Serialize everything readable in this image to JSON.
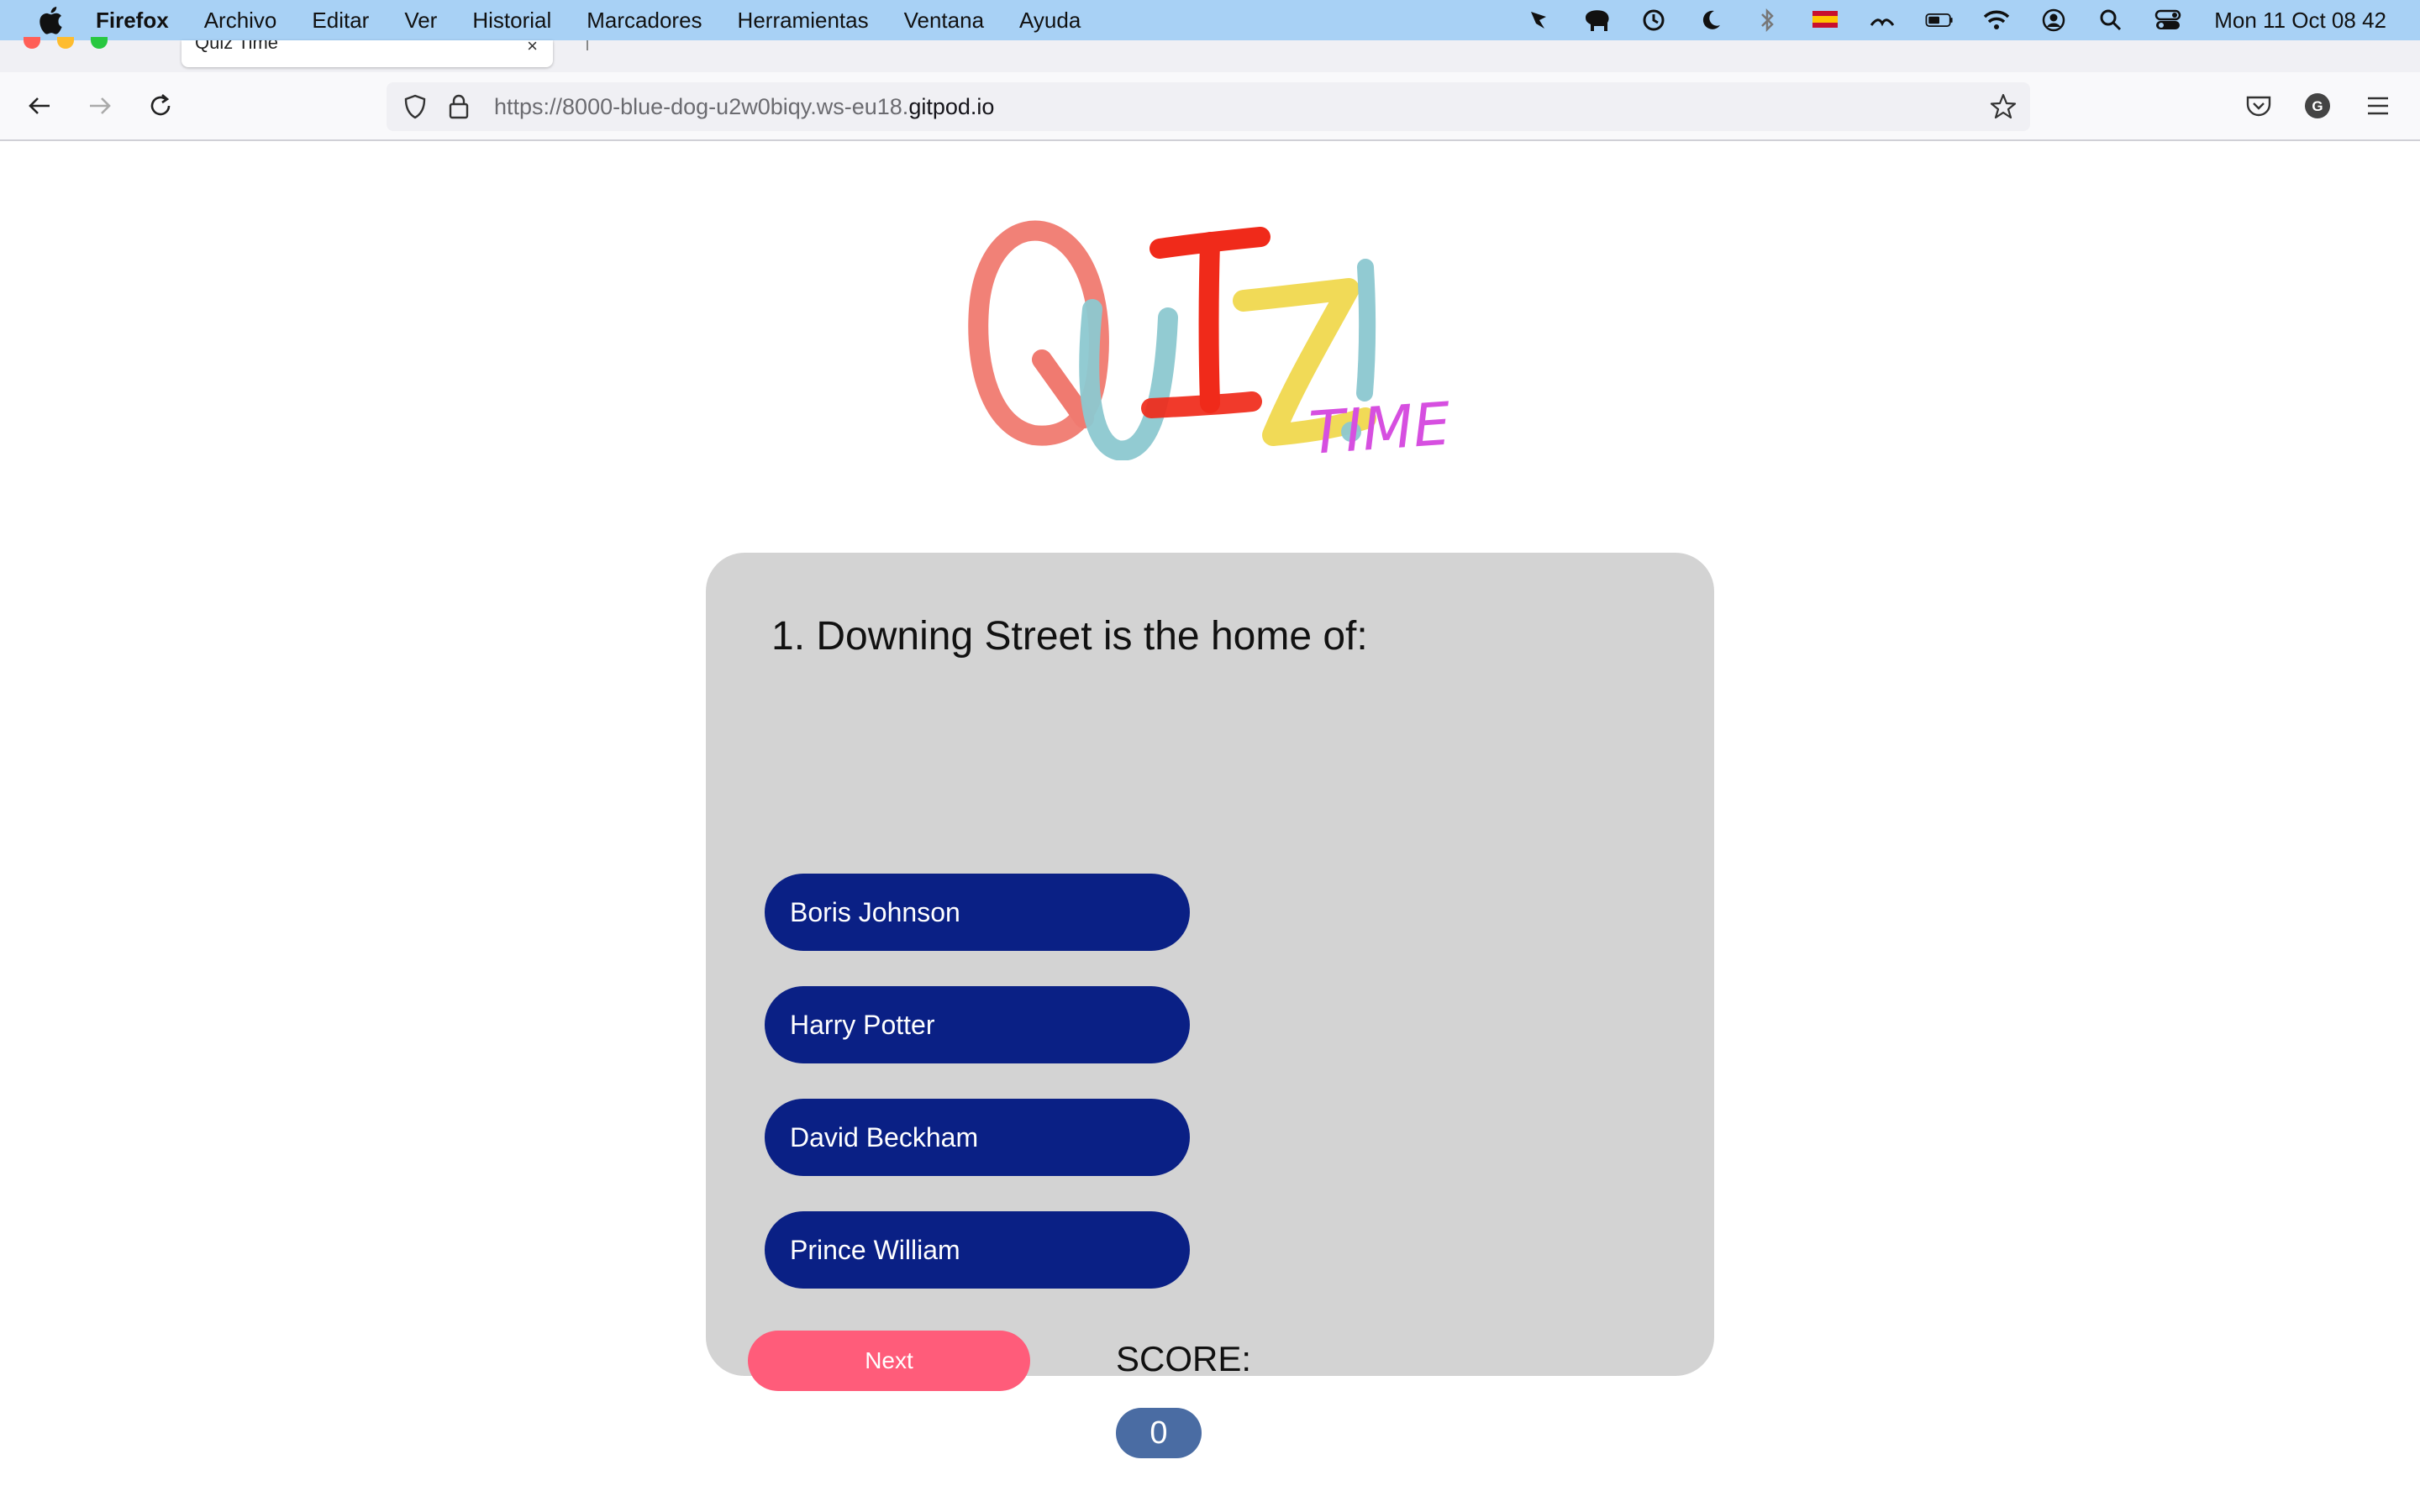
{
  "menubar": {
    "app_name": "Firefox",
    "items": [
      "Archivo",
      "Editar",
      "Ver",
      "Historial",
      "Marcadores",
      "Herramientas",
      "Ventana",
      "Ayuda"
    ],
    "clock": "Mon 11 Oct  08 42"
  },
  "tab": {
    "title": "Quiz Time",
    "close": "×"
  },
  "urlbar": {
    "url_prefix": "https://8000-blue-dog-u2w0biqy.ws-eu18.",
    "url_host": "gitpod.io"
  },
  "logo": {
    "word": "QUIZ!",
    "subword": "TIME",
    "colors": [
      "#f07a70",
      "#8cc8d0",
      "#f02a1a",
      "#f0d84e",
      "#d64fe0"
    ]
  },
  "quiz": {
    "question": "1. Downing Street is the home of:",
    "answers": [
      "Boris Johnson",
      "Harry Potter",
      "David Beckham",
      "Prince William"
    ],
    "next_label": "Next",
    "score_label": "SCORE:",
    "score_value": "0",
    "answer_color": "#0a2085",
    "next_color": "#ff5c7a",
    "card_color": "#d3d3d3"
  }
}
